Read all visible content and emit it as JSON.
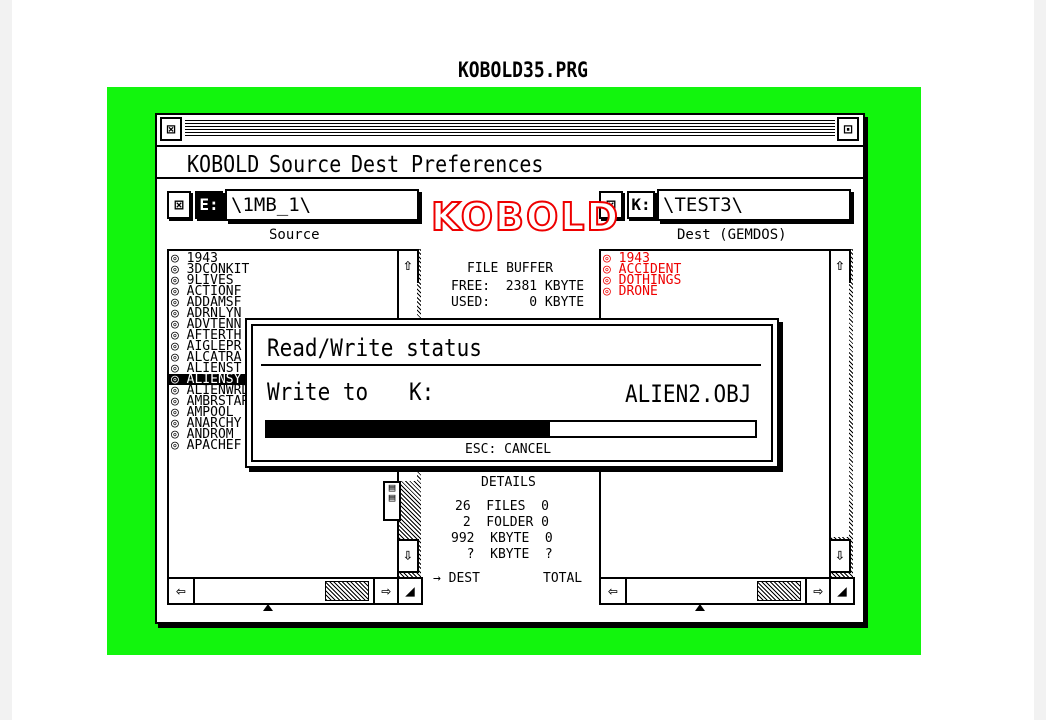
{
  "caption": "KOBOLD35.PRG",
  "window": {
    "close_glyph": "⊠",
    "fuller_glyph": "⊡"
  },
  "menu": [
    "KOBOLD",
    "Source",
    "Dest",
    "Preferences"
  ],
  "source": {
    "close_glyph": "⊠",
    "drive": "E:",
    "path": "\\1MB_1\\",
    "label": "Source",
    "items": [
      "◎ 1943",
      "◎ 3DCONKIT",
      "◎ 9LIVES",
      "◎ ACTIONF",
      "◎ ADDAMSF",
      "◎ ADRNLYN",
      "◎ ADVTENN",
      "◎ AFTERTH",
      "◎ AIGLEPR",
      "◎ ALCATRA",
      "◎ ALIENST",
      "◎ ALIENSY",
      "◎ ALIENWRD",
      "◎ AMBRSTAR",
      "◎ AMPOOL",
      "◎ ANARCHY",
      "◎ ANDROM",
      "◎ APACHEF"
    ],
    "selected_index": 11
  },
  "dest": {
    "close_glyph": "⊠",
    "drive": "K:",
    "path": "\\TEST3\\",
    "label": "Dest (GEMDOS)",
    "items": [
      "◎ 1943",
      "◎ ACCIDENT",
      "◎ DOTHINGS",
      "◎ DRONE"
    ]
  },
  "logo": "KOBOLD",
  "buffer": {
    "title": "FILE BUFFER",
    "free": "FREE:  2381 KBYTE",
    "used": "USED:     0 KBYTE"
  },
  "details": {
    "title": "DETAILS",
    "rows": [
      "26  FILES  0",
      " 2  FOLDER 0",
      "992  KBYTE  0",
      "  ?  KBYTE  ?"
    ],
    "footer_left": "→ DEST",
    "footer_right": "TOTAL"
  },
  "dialog": {
    "title": "Read/Write status",
    "action": "Write to",
    "drive": "K:",
    "file": "ALIEN2.OBJ",
    "progress": 0.58,
    "cancel": "ESC: CANCEL"
  },
  "scroll": {
    "up": "⇧",
    "down": "⇩",
    "left": "⇦",
    "right": "⇨",
    "size": "◢"
  }
}
